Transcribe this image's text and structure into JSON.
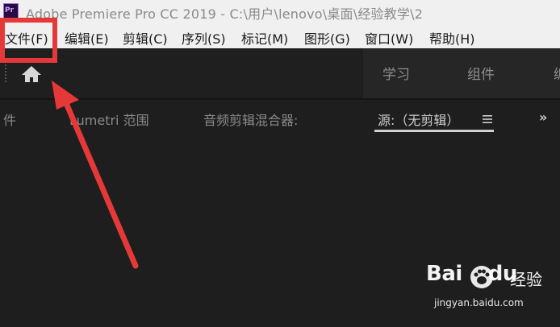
{
  "titlebar": {
    "app_icon_text": "Pr",
    "title": "Adobe Premiere Pro CC 2019 - C:\\用户\\lenovo\\桌面\\经验教学\\2"
  },
  "menu": {
    "items": [
      "文件(F)",
      "编辑(E)",
      "剪辑(C)",
      "序列(S)",
      "标记(M)",
      "图形(G)",
      "窗口(W)",
      "帮助(H)"
    ]
  },
  "workspace": {
    "home_icon": "home-icon",
    "tabs": [
      "学习",
      "组件",
      "编"
    ]
  },
  "panels": {
    "tabs": [
      "件",
      "Lumetri 范围",
      "音频剪辑混合器:",
      "源:（无剪辑）"
    ],
    "active_index": 3,
    "menu_icon": "hamburger-icon",
    "overflow_label": "»"
  },
  "annotation": {
    "color": "#e53939"
  },
  "watermark": {
    "logo": "Bai",
    "logo_tail": "du",
    "brand": "经验",
    "url": "jingyan.baidu.com"
  }
}
